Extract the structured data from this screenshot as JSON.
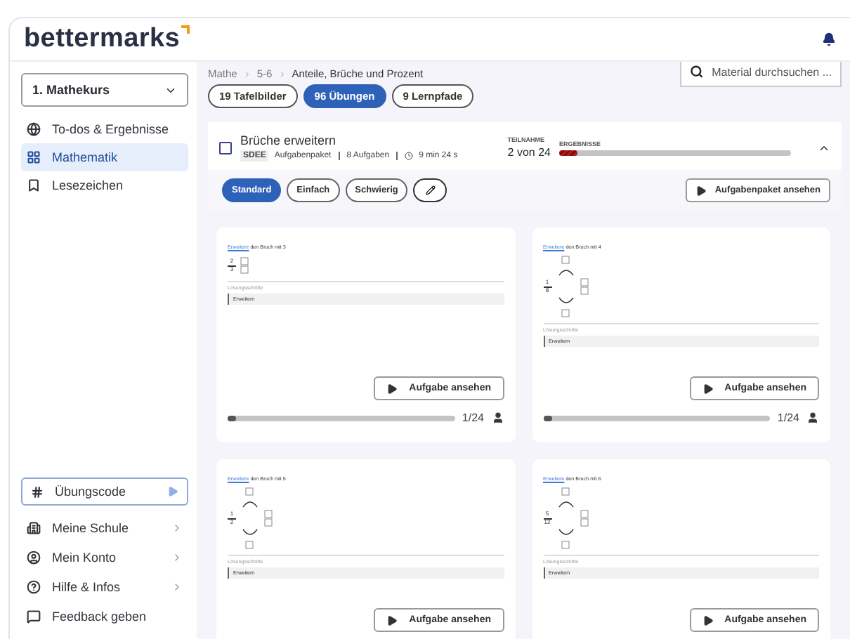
{
  "logo": {
    "text": "bettermarks"
  },
  "sidebar": {
    "course_select": {
      "value": "1. Mathekurs"
    },
    "nav": [
      {
        "label": "To-dos & Ergebnisse",
        "selected": false
      },
      {
        "label": "Mathematik",
        "selected": true
      },
      {
        "label": "Lesezeichen",
        "selected": false
      }
    ],
    "code_field": {
      "label": "Übungscode"
    },
    "footer": [
      {
        "label": "Meine Schule",
        "chevron": true
      },
      {
        "label": "Mein Konto",
        "chevron": true
      },
      {
        "label": "Hilfe & Infos",
        "chevron": true
      },
      {
        "label": "Feedback geben",
        "chevron": false
      }
    ]
  },
  "breadcrumb": [
    "Mathe",
    "5-6",
    "Anteile, Brüche und Prozent"
  ],
  "chips": [
    {
      "label": "19 Tafelbilder",
      "selected": false
    },
    {
      "label": "96 Übungen",
      "selected": true
    },
    {
      "label": "9 Lernpfade",
      "selected": false
    }
  ],
  "search": {
    "placeholder": "Material durchsuchen ..."
  },
  "package": {
    "title": "Brüche erweitern",
    "checked": false,
    "code": "SDEE",
    "type": "Aufgabenpaket",
    "count": "8 Aufgaben",
    "duration": "9 min 24 s",
    "participation_label": "TEILNAHME",
    "participation": "2 von 24",
    "results": {
      "label": "ERGEBNISSE",
      "level": 0.08
    },
    "expanded": true
  },
  "levels": [
    {
      "label": "Standard",
      "selected": true
    },
    {
      "label": "Einfach",
      "selected": false
    },
    {
      "label": "Schwierig",
      "selected": false
    }
  ],
  "view_package": "Aufgabenpaket ansehen",
  "cards": [
    {
      "kind": "inline",
      "link": "Erweitere",
      "instruction": "den Bruch mit 3",
      "num": "2",
      "den": "3",
      "steps_label": "Lösungsschritte",
      "step": "Erweitern",
      "button": "Aufgabe ansehen",
      "progress": {
        "level": 0.04,
        "reading": "1/24"
      }
    },
    {
      "kind": "arrows",
      "link": "Erweitere",
      "instruction": "den Bruch mit 4",
      "num": "1",
      "den": "8",
      "steps_label": "Lösungsschritte",
      "step": "Erweitern",
      "button": "Aufgabe ansehen",
      "progress": {
        "level": 0.04,
        "reading": "1/24"
      }
    },
    {
      "kind": "arrows",
      "link": "Erweitere",
      "instruction": "den Bruch mit 5",
      "num": "1",
      "den": "2",
      "steps_label": "Lösungsschritte",
      "step": "Erweitern",
      "button": "Aufgabe ansehen"
    },
    {
      "kind": "arrows",
      "link": "Erweitere",
      "instruction": "den Bruch mit 6",
      "num": "5",
      "den": "12",
      "steps_label": "Lösungsschritte",
      "step": "Erweitern",
      "button": "Aufgabe ansehen"
    }
  ]
}
